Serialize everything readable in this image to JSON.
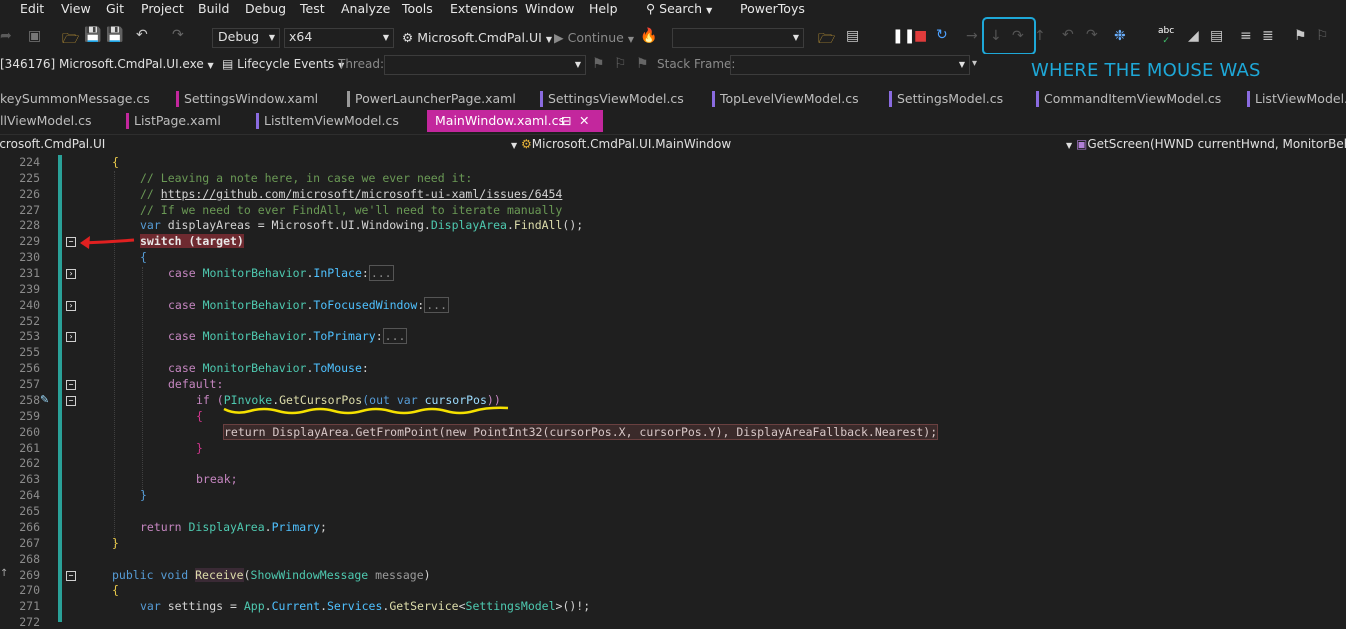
{
  "menu": [
    "Edit",
    "View",
    "Git",
    "Project",
    "Build",
    "Debug",
    "Test",
    "Analyze",
    "Tools",
    "Extensions",
    "Window",
    "Help"
  ],
  "search_label": "Search",
  "powertoys_label": "PowerToys",
  "toolbar": {
    "config": "Debug",
    "platform": "x64",
    "startup_project": "Microsoft.CmdPal.UI",
    "continue_label": "Continue"
  },
  "debug_bar": {
    "process": "[346176] Microsoft.CmdPal.UI.exe",
    "lifecycle": "Lifecycle Events",
    "thread_label": "Thread:",
    "stack_frame_label": "Stack Frame:"
  },
  "annotation": "WHERE THE MOUSE WAS",
  "tabs_row1": [
    "keySummonMessage.cs",
    "SettingsWindow.xaml",
    "PowerLauncherPage.xaml",
    "SettingsViewModel.cs",
    "TopLevelViewModel.cs",
    "SettingsModel.cs",
    "CommandItemViewModel.cs",
    "ListViewModel.cs"
  ],
  "tabs_row2": [
    "llViewModel.cs",
    "ListPage.xaml",
    "ListItemViewModel.cs",
    "MainWindow.xaml.cs"
  ],
  "nav": {
    "project": "icrosoft.CmdPal.UI",
    "class": "Microsoft.CmdPal.UI.MainWindow",
    "member": "GetScreen(HWND currentHwnd, MonitorBehav"
  },
  "line_numbers": [
    "224",
    "225",
    "226",
    "227",
    "228",
    "229",
    "230",
    "231",
    "239",
    "240",
    "252",
    "253",
    "255",
    "256",
    "257",
    "258",
    "259",
    "260",
    "261",
    "262",
    "263",
    "264",
    "265",
    "266",
    "267",
    "268",
    "269",
    "270",
    "271",
    "272"
  ],
  "code": {
    "l224": "{",
    "l225": "// Leaving a note here, in case we ever need it:",
    "l226a": "// ",
    "l226b": "https://github.com/microsoft/microsoft-ui-xaml/issues/6454",
    "l227": "// If we need to ever FindAll, we'll need to iterate manually",
    "l228": [
      "var",
      " displayAreas = Microsoft.UI.Windowing.",
      "DisplayArea",
      ".",
      "FindAll",
      "();"
    ],
    "l229": [
      "switch",
      " (target)"
    ],
    "l230": "{",
    "l231": [
      "case ",
      "MonitorBehavior",
      ".",
      "InPlace",
      ":",
      "..."
    ],
    "l240": [
      "case ",
      "MonitorBehavior",
      ".",
      "ToFocusedWindow",
      ":",
      "..."
    ],
    "l253": [
      "case ",
      "MonitorBehavior",
      ".",
      "ToPrimary",
      ":",
      "..."
    ],
    "l256": [
      "case ",
      "MonitorBehavior",
      ".",
      "ToMouse",
      ":"
    ],
    "l257": "default:",
    "l258": [
      "if",
      " (",
      "PInvoke",
      ".",
      "GetCursorPos",
      "(",
      "out",
      " ",
      "var",
      " cursorPos",
      "))"
    ],
    "l259": "{",
    "l260": "return DisplayArea.GetFromPoint(new PointInt32(cursorPos.X, cursorPos.Y), DisplayAreaFallback.Nearest);",
    "l261": "}",
    "l263": "break;",
    "l264": "}",
    "l266": [
      "return ",
      "DisplayArea",
      ".",
      "Primary",
      ";"
    ],
    "l267": "}",
    "l269": [
      "public",
      " ",
      "void",
      " ",
      "Receive",
      "(",
      "ShowWindowMessage",
      " message",
      ")"
    ],
    "l270": "{",
    "l271": [
      "var",
      " settings = ",
      "App",
      ".",
      "Current",
      ".",
      "Services",
      ".",
      "GetService",
      "<",
      "SettingsModel",
      ">()!;"
    ]
  },
  "colors": {
    "accent_tab": "#c3279d",
    "annotation": "#1ea8d8",
    "arrow": "#e02020",
    "squiggle": "#f5e100"
  }
}
